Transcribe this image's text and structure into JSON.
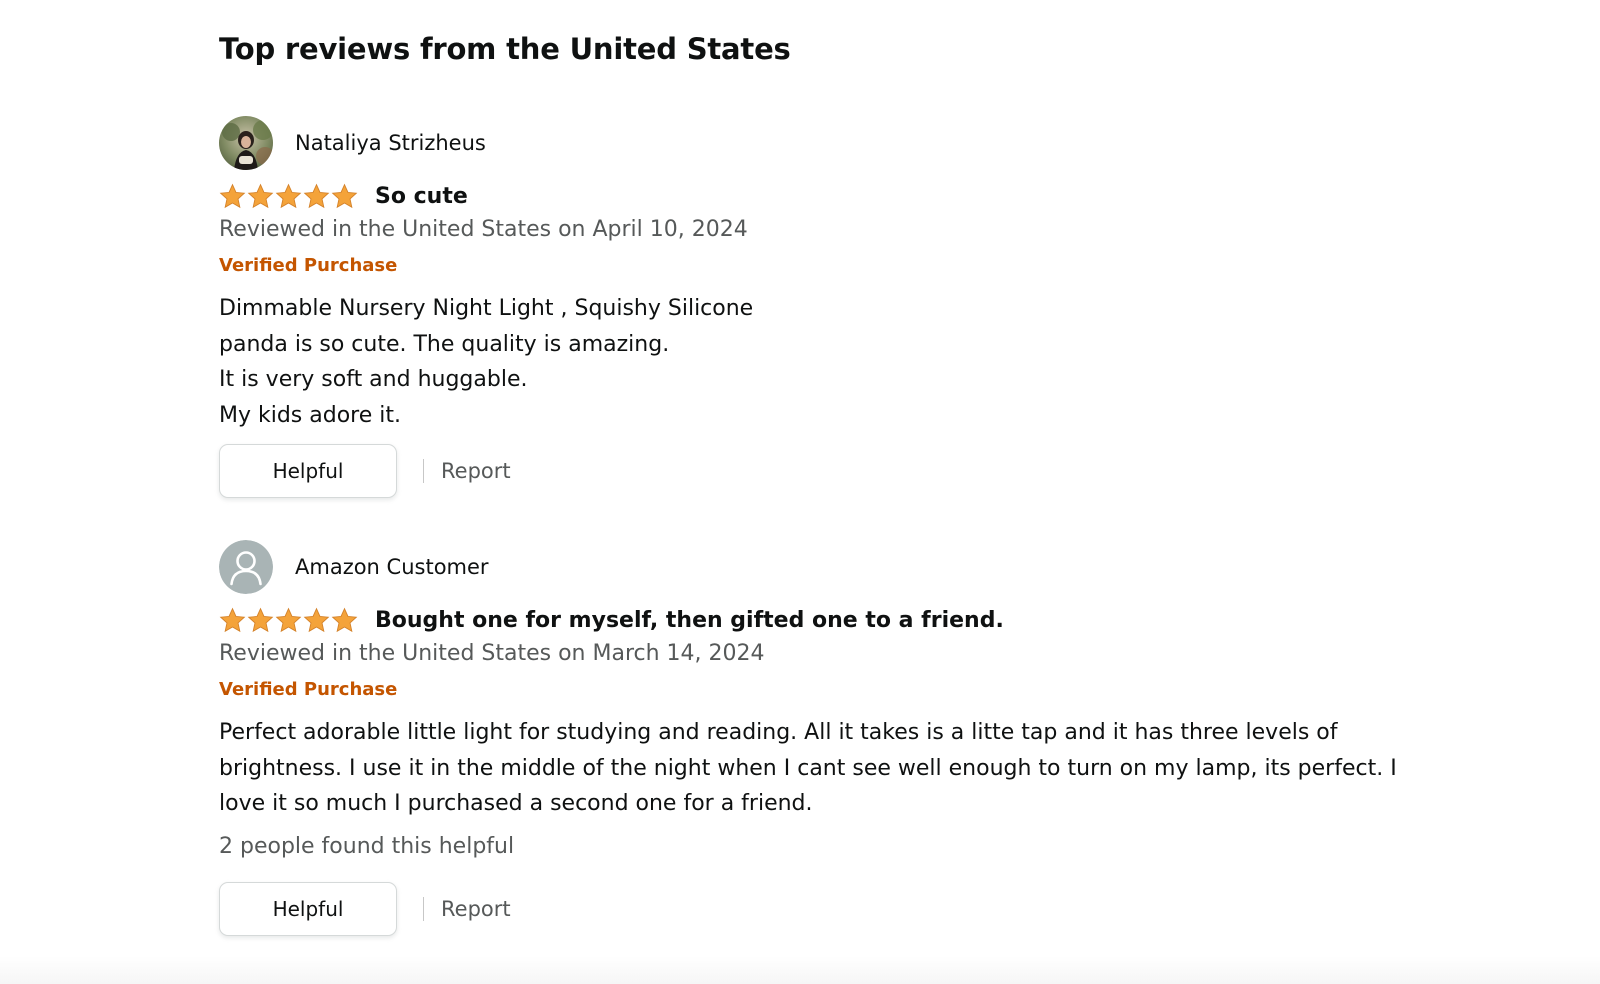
{
  "section_title": "Top reviews from the United States",
  "colors": {
    "star": "#f4a33a",
    "verified": "#c45500",
    "muted_text": "#565959"
  },
  "reviews": [
    {
      "profile_name": "Nataliya Strizheus",
      "avatar_icon": "user-photo-avatar",
      "rating": 5,
      "rating_max": 5,
      "title": "So cute",
      "date": "Reviewed in the United States on April 10, 2024",
      "verified": "Verified Purchase",
      "body": "Dimmable Nursery Night Light , Squishy Silicone\npanda is so cute. The quality is amazing.\nIt is very soft and huggable.\nMy kids adore it.",
      "helpful_count": "",
      "helpful_label": "Helpful",
      "report_label": "Report"
    },
    {
      "profile_name": "Amazon Customer",
      "avatar_icon": "default-user-icon",
      "rating": 5,
      "rating_max": 5,
      "title": "Bought one for myself, then gifted one to a friend.",
      "date": "Reviewed in the United States on March 14, 2024",
      "verified": "Verified Purchase",
      "body": "Perfect adorable little light for studying and reading. All it takes is a litte tap and it has three levels of\nbrightness. I use it in the middle of the night when I cant see well enough to turn on my lamp, its perfect. I\nlove it so much I purchased a second one for a friend.",
      "helpful_count": "2 people found this helpful",
      "helpful_label": "Helpful",
      "report_label": "Report"
    }
  ]
}
